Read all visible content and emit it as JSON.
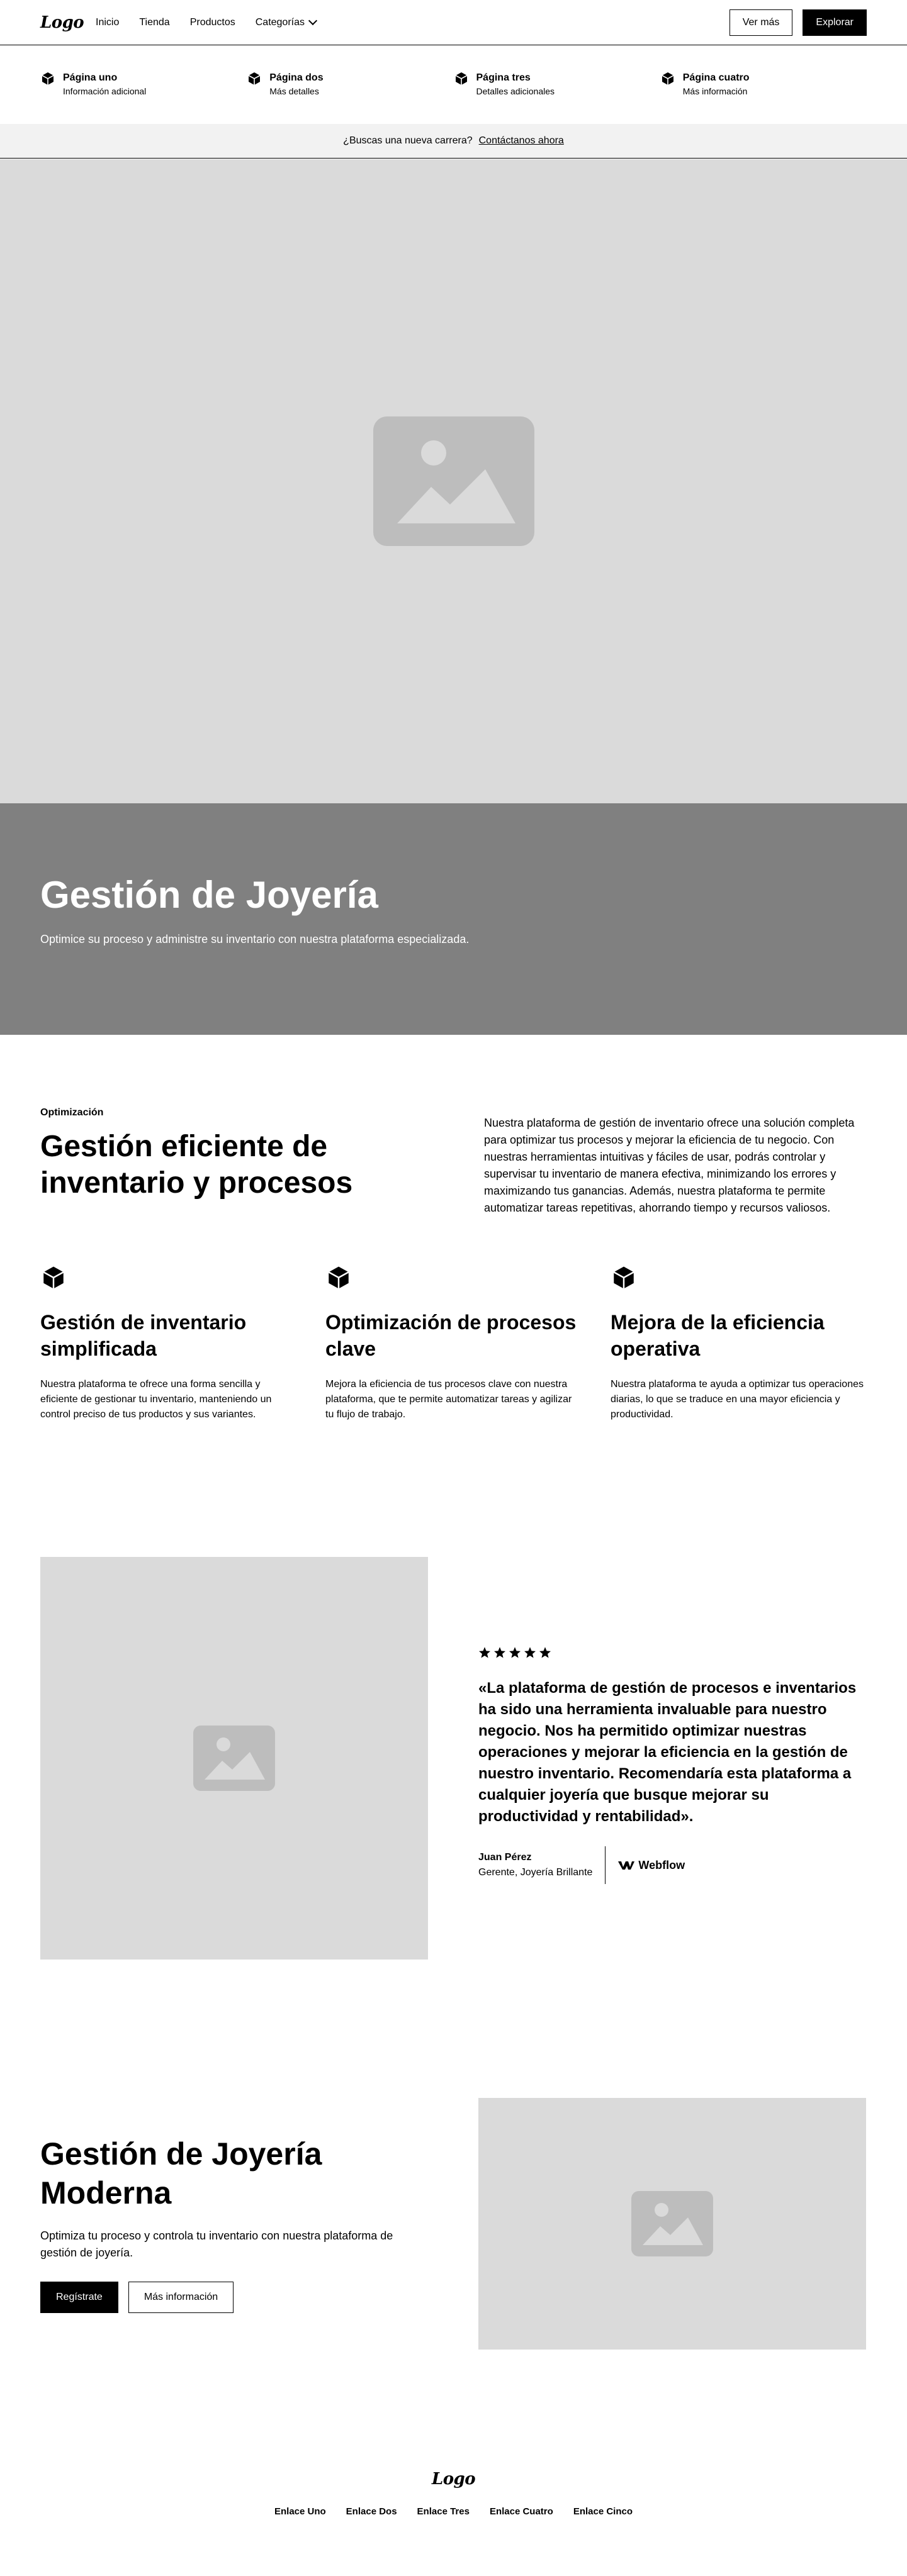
{
  "nav": {
    "logo": "Logo",
    "links": [
      "Inicio",
      "Tienda",
      "Productos"
    ],
    "dropdown_label": "Categorías",
    "secondary_button": "Ver más",
    "primary_button": "Explorar"
  },
  "megamenu": {
    "items": [
      {
        "title": "Página uno",
        "subtitle": "Información adicional"
      },
      {
        "title": "Página dos",
        "subtitle": "Más detalles"
      },
      {
        "title": "Página tres",
        "subtitle": "Detalles adicionales"
      },
      {
        "title": "Página cuatro",
        "subtitle": "Más información"
      }
    ]
  },
  "banner": {
    "text": "¿Buscas una nueva carrera?",
    "link": "Contáctanos ahora"
  },
  "hero": {
    "title": "Gestión de Joyería",
    "subtitle": "Optimice su proceso y administre su inventario con nuestra plataforma especializada."
  },
  "features": {
    "tagline": "Optimización",
    "heading": "Gestión eficiente de inventario y procesos",
    "description": "Nuestra plataforma de gestión de inventario ofrece una solución completa para optimizar tus procesos y mejorar la eficiencia de tu negocio. Con nuestras herramientas intuitivas y fáciles de usar, podrás controlar y supervisar tu inventario de manera efectiva, minimizando los errores y maximizando tus ganancias. Además, nuestra plataforma te permite automatizar tareas repetitivas, ahorrando tiempo y recursos valiosos.",
    "columns": [
      {
        "title": "Gestión de inventario simplificada",
        "text": "Nuestra plataforma te ofrece una forma sencilla y eficiente de gestionar tu inventario, manteniendo un control preciso de tus productos y sus variantes."
      },
      {
        "title": "Optimización de procesos clave",
        "text": "Mejora la eficiencia de tus procesos clave con nuestra plataforma, que te permite automatizar tareas y agilizar tu flujo de trabajo."
      },
      {
        "title": "Mejora de la eficiencia operativa",
        "text": "Nuestra plataforma te ayuda a optimizar tus operaciones diarias, lo que se traduce en una mayor eficiencia y productividad."
      }
    ]
  },
  "testimonial": {
    "rating": 5,
    "quote": "«La plataforma de gestión de procesos e inventarios ha sido una herramienta invaluable para nuestro negocio. Nos ha permitido optimizar nuestras operaciones y mejorar la eficiencia en la gestión de nuestro inventario. Recomendaría esta plataforma a cualquier joyería que busque mejorar su productividad y rentabilidad».",
    "author_name": "Juan Pérez",
    "author_role": "Gerente, Joyería Brillante",
    "company": "Webflow"
  },
  "cta": {
    "heading": "Gestión de Joyería Moderna",
    "text": "Optimiza tu proceso y controla tu inventario con nuestra plataforma de gestión de joyería.",
    "primary_button": "Regístrate",
    "secondary_button": "Más información"
  },
  "footer": {
    "logo": "Logo",
    "links": [
      "Enlace Uno",
      "Enlace Dos",
      "Enlace Tres",
      "Enlace Cuatro",
      "Enlace Cinco"
    ]
  },
  "colors": {
    "placeholder_bg": "#dadada",
    "hero_overlay": "#808080",
    "banner_bg": "#f2f2f2",
    "ink": "#000000"
  },
  "icons": {
    "menu_item": "cube-icon",
    "feature": "cube-icon",
    "image": "image-placeholder-icon",
    "rating": "star-icon",
    "dropdown": "chevron-down-icon"
  }
}
